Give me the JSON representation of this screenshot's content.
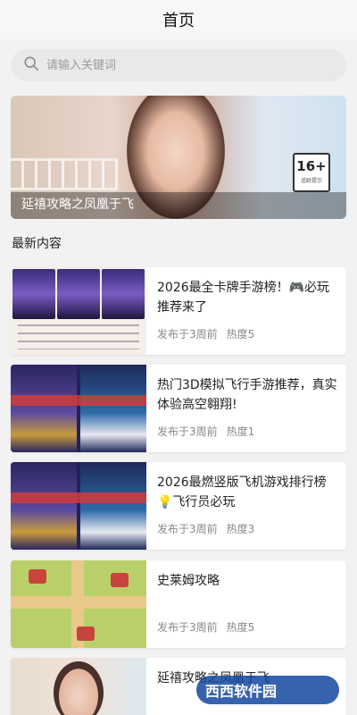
{
  "header": {
    "title": "首页"
  },
  "search": {
    "placeholder": "请输入关键词"
  },
  "banner": {
    "caption": "延禧攻略之凤凰于飞",
    "age_rating": "16+",
    "age_note": "适龄提示"
  },
  "section": {
    "title": "最新内容"
  },
  "articles": [
    {
      "title": "2026最全卡牌手游榜！🎮必玩推荐来了",
      "published": "发布于3周前",
      "heat": "热度5"
    },
    {
      "title": "热门3D模拟飞行手游推荐，真实体验高空翱翔!",
      "published": "发布于3周前",
      "heat": "热度1"
    },
    {
      "title": "2026最燃竖版飞机游戏排行榜💡飞行员必玩",
      "published": "发布于3周前",
      "heat": "热度3"
    },
    {
      "title": "史莱姆攻略",
      "published": "发布于3周前",
      "heat": "热度5"
    },
    {
      "title": "延禧攻略之凤凰于飞",
      "published": "",
      "heat": ""
    }
  ],
  "watermark": {
    "text": "西西软件园"
  },
  "colors": {
    "background": "#f2f2f2",
    "card": "#ffffff",
    "meta": "#888888"
  }
}
